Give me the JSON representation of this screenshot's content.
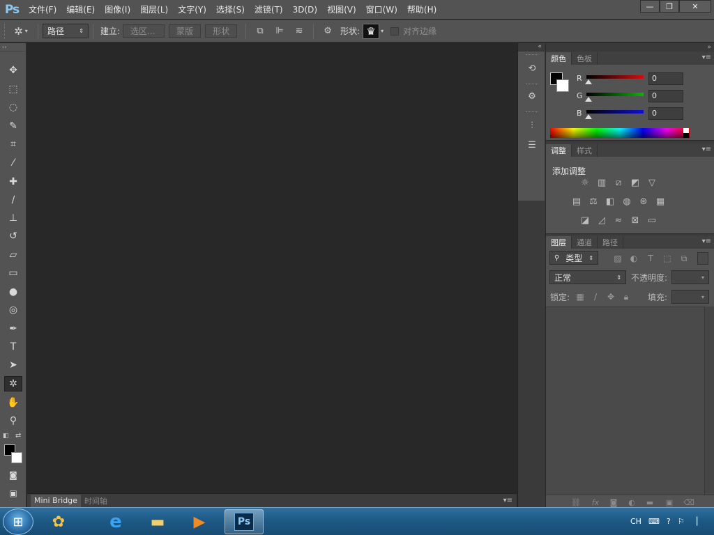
{
  "app": {
    "logo": "Ps"
  },
  "menu": [
    "文件(F)",
    "编辑(E)",
    "图像(I)",
    "图层(L)",
    "文字(Y)",
    "选择(S)",
    "滤镜(T)",
    "3D(D)",
    "视图(V)",
    "窗口(W)",
    "帮助(H)"
  ],
  "window_controls": {
    "minimize": "—",
    "restore": "❐",
    "close": "✕"
  },
  "options": {
    "mode_select": "路径",
    "build_label": "建立:",
    "selection_btn": "选区...",
    "mask_btn": "蒙版",
    "shape_btn": "形状",
    "shape_label": "形状:",
    "align_edges_label": "对齐边缘"
  },
  "toolbox": {
    "tools": [
      {
        "name": "move-tool",
        "glyph": "✥"
      },
      {
        "name": "marquee-tool",
        "glyph": "⬚"
      },
      {
        "name": "lasso-tool",
        "glyph": "◌"
      },
      {
        "name": "quick-select-tool",
        "glyph": "✎"
      },
      {
        "name": "crop-tool",
        "glyph": "⌗"
      },
      {
        "name": "eyedropper-tool",
        "glyph": "⁄"
      },
      {
        "name": "healing-brush-tool",
        "glyph": "✚"
      },
      {
        "name": "brush-tool",
        "glyph": "∕"
      },
      {
        "name": "stamp-tool",
        "glyph": "⊥"
      },
      {
        "name": "history-brush-tool",
        "glyph": "↺"
      },
      {
        "name": "eraser-tool",
        "glyph": "▱"
      },
      {
        "name": "gradient-tool",
        "glyph": "▭"
      },
      {
        "name": "blur-tool",
        "glyph": "●"
      },
      {
        "name": "dodge-tool",
        "glyph": "◎"
      },
      {
        "name": "pen-tool",
        "glyph": "✒"
      },
      {
        "name": "type-tool",
        "glyph": "T"
      },
      {
        "name": "path-select-tool",
        "glyph": "➤"
      },
      {
        "name": "custom-shape-tool",
        "glyph": "✲"
      },
      {
        "name": "hand-tool",
        "glyph": "✋"
      },
      {
        "name": "zoom-tool",
        "glyph": "⚲"
      }
    ]
  },
  "bottom_tabs": [
    "Mini Bridge",
    "时间轴"
  ],
  "color_panel": {
    "tabs": [
      "颜色",
      "色板"
    ],
    "sliders": [
      {
        "label": "R",
        "value": "0",
        "color": "#d01010"
      },
      {
        "label": "G",
        "value": "0",
        "color": "#10b010"
      },
      {
        "label": "B",
        "value": "0",
        "color": "#1010d0"
      }
    ]
  },
  "adjustments_panel": {
    "tabs": [
      "调整",
      "样式"
    ],
    "title": "添加调整"
  },
  "layers_panel": {
    "tabs": [
      "图层",
      "通道",
      "路径"
    ],
    "filter_select": "类型",
    "blend_mode": "正常",
    "opacity_label": "不透明度:",
    "lock_label": "锁定:",
    "fill_label": "填充:"
  },
  "taskbar": {
    "tray_lang": "CH"
  }
}
